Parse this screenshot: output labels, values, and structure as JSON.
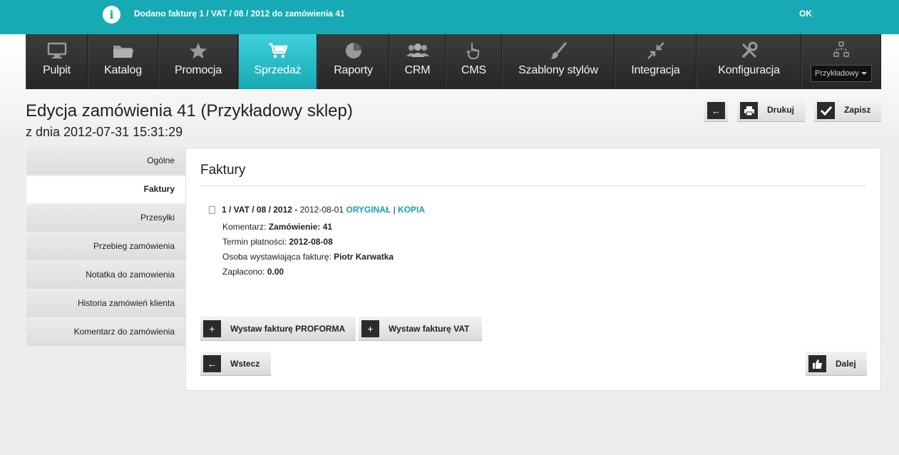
{
  "notification": {
    "icon": "info-icon",
    "text": "Dodano fakturę 1 / VAT / 08 / 2012 do zamówienia 41",
    "ok": "OK"
  },
  "nav": {
    "items": [
      {
        "label": "Pulpit",
        "icon": "monitor-icon"
      },
      {
        "label": "Katalog",
        "icon": "folder-icon"
      },
      {
        "label": "Promocja",
        "icon": "star-icon"
      },
      {
        "label": "Sprzedaż",
        "icon": "cart-icon",
        "active": true
      },
      {
        "label": "Raporty",
        "icon": "pie-chart-icon"
      },
      {
        "label": "CRM",
        "icon": "users-icon"
      },
      {
        "label": "CMS",
        "icon": "hand-pointer-icon"
      },
      {
        "label": "Szablony stylów",
        "icon": "brush-icon"
      },
      {
        "label": "Integracja",
        "icon": "arrows-in-icon"
      },
      {
        "label": "Konfiguracja",
        "icon": "tools-icon"
      }
    ],
    "store_select": "Przykładowy"
  },
  "page": {
    "title": "Edycja zamówienia 41 (Przykładowy sklep)",
    "subtitle": "z dnia 2012-07-31 15:31:29"
  },
  "toolbar": {
    "print": "Drukuj",
    "save": "Zapisz"
  },
  "sidebar": {
    "items": [
      {
        "label": "Ogólne"
      },
      {
        "label": "Faktury",
        "active": true
      },
      {
        "label": "Przesyłki"
      },
      {
        "label": "Przebieg zamówienia"
      },
      {
        "label": "Notatka do zamowienia"
      },
      {
        "label": "Historia zamówień klienta"
      },
      {
        "label": "Komentarz do zamówienia"
      }
    ]
  },
  "panel": {
    "heading": "Faktury",
    "invoice": {
      "number": "1 / VAT / 08 / 2012",
      "separator": " - ",
      "date": "2012-08-01",
      "original": "ORYGINAŁ",
      "pipe": " | ",
      "copy": "KOPIA",
      "comment_label": "Komentarz: ",
      "comment_value": "Zamówienie: 41",
      "due_label": "Termin płatności: ",
      "due_value": "2012-08-08",
      "issuer_label": "Osoba wystawiająca fakturę: ",
      "issuer_value": "Piotr Karwatka",
      "paid_label": "Zapłacono: ",
      "paid_value": "0.00"
    },
    "buttons": {
      "proforma": "Wystaw fakturę PROFORMA",
      "vat": "Wystaw fakturę VAT",
      "back": "Wstecz",
      "next": "Dalej"
    }
  },
  "colors": {
    "accent": "#17aab5",
    "nav_bg": "#2e2e2e",
    "link": "#1a9fab"
  }
}
